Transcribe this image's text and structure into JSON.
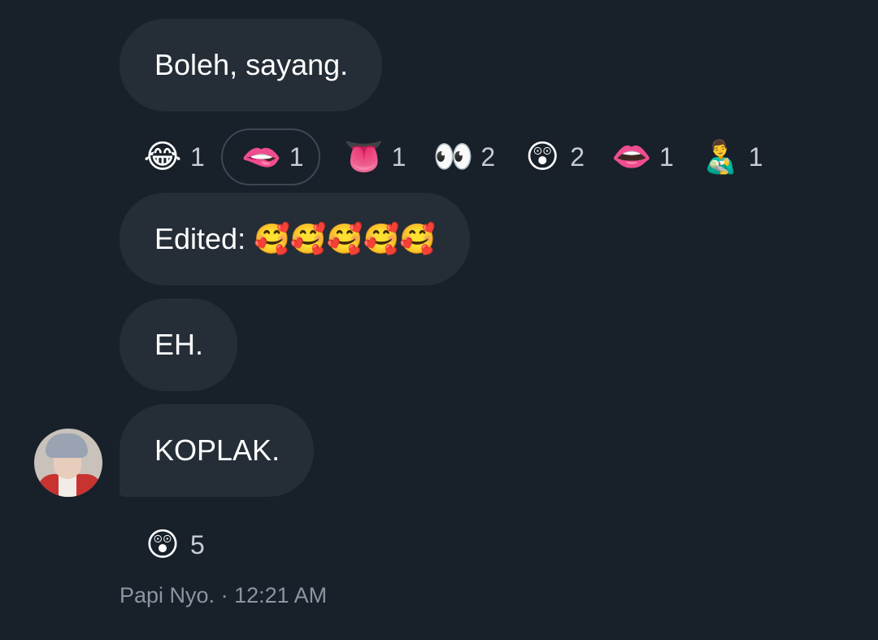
{
  "messages": [
    {
      "text": "Boleh, sayang."
    },
    {
      "text": "Edited: 🥰🥰🥰🥰🥰"
    },
    {
      "text": "EH."
    },
    {
      "text": "KOPLAK."
    }
  ],
  "reactions_row1": [
    {
      "emoji": "😂",
      "icon": "tears-of-joy-icon",
      "count": "1",
      "selected": false
    },
    {
      "emoji": "🫦",
      "icon": "biting-lip-icon",
      "count": "1",
      "selected": true
    },
    {
      "emoji": "👅",
      "icon": "tongue-icon",
      "count": "1",
      "selected": false
    },
    {
      "emoji": "👀",
      "icon": "eyes-icon",
      "count": "2",
      "selected": false
    },
    {
      "emoji": "😲",
      "icon": "astonished-face-icon",
      "count": "2",
      "selected": false
    },
    {
      "emoji": "👄",
      "icon": "mouth-icon",
      "count": "1",
      "selected": false
    },
    {
      "emoji": "👨‍🍼",
      "icon": "man-feeding-baby-icon",
      "count": "1",
      "selected": false
    }
  ],
  "reactions_row2": [
    {
      "emoji": "😲",
      "icon": "astonished-face-icon",
      "count": "5",
      "selected": false
    }
  ],
  "meta": {
    "sender": "Papi Nyo.",
    "separator": "·",
    "time": "12:21 AM"
  },
  "colors": {
    "background": "#18202a",
    "bubble": "#252d37",
    "selected_border": "#3e4853",
    "count_text": "#c7cdd3",
    "meta_text": "#8b96a1"
  }
}
